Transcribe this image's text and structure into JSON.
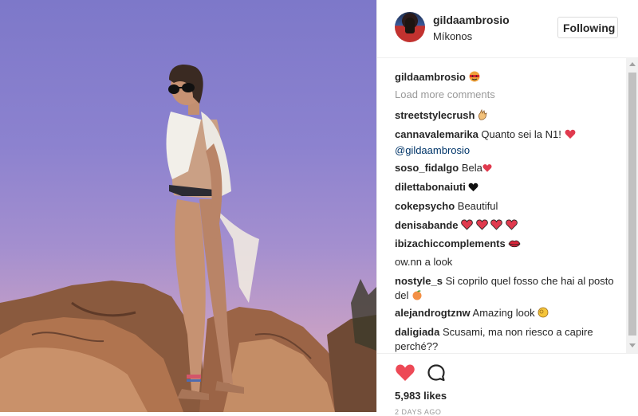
{
  "post": {
    "username": "gildaambrosio",
    "location": "Míkonos",
    "follow_label": "Following",
    "caption_username": "gildaambrosio",
    "load_more": "Load more comments",
    "likes": "5,983 likes",
    "time": "2 DAYS AGO"
  },
  "comments": [
    {
      "user": "streetstylecrush",
      "text": ""
    },
    {
      "user": "cannavalemarika",
      "text": "Quanto sei la N1!",
      "mention": "@gildaambrosio"
    },
    {
      "user": "soso_fidalgo",
      "text": "Bela"
    },
    {
      "user": "dilettabonaiuti",
      "text": ""
    },
    {
      "user": "cokepsycho",
      "text": "Beautiful"
    },
    {
      "user": "denisabande",
      "text": ""
    },
    {
      "user": "ibizachiccomplements",
      "text": ""
    },
    {
      "user": "ow.nn",
      "text": "a look"
    },
    {
      "user": "nostyle_s",
      "text": "Si coprilo quel fosso che hai al posto del"
    },
    {
      "user": "alejandrogtznw",
      "text": "Amazing look"
    },
    {
      "user": "daligiada",
      "text": "Scusami, ma non riesco a capire perché??"
    }
  ],
  "icons": {
    "heart": "heart-icon",
    "comment": "comment-icon"
  },
  "colors": {
    "heart": "#ed4956",
    "mention": "#003569"
  }
}
